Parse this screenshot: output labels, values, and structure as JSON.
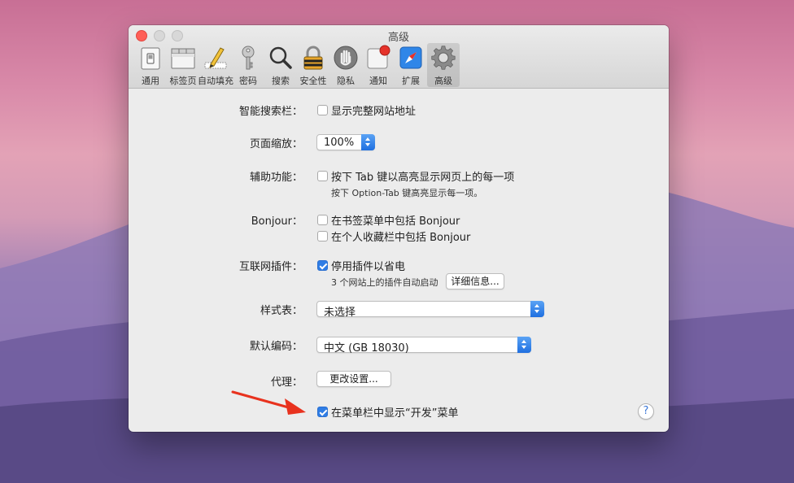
{
  "window": {
    "title": "高级"
  },
  "toolbar": {
    "items": [
      {
        "label": "通用",
        "icon": "general-switch-icon"
      },
      {
        "label": "标签页",
        "icon": "tabs-window-icon"
      },
      {
        "label": "自动填充",
        "icon": "pencil-form-icon"
      },
      {
        "label": "密码",
        "icon": "key-icon"
      },
      {
        "label": "搜索",
        "icon": "magnifier-icon"
      },
      {
        "label": "安全性",
        "icon": "padlock-icon"
      },
      {
        "label": "隐私",
        "icon": "hand-icon"
      },
      {
        "label": "通知",
        "icon": "notification-icon"
      },
      {
        "label": "扩展",
        "icon": "safari-compass-icon"
      },
      {
        "label": "高级",
        "icon": "gear-icon",
        "selected": true
      }
    ]
  },
  "settings": {
    "smart_search": {
      "label": "智能搜索栏：",
      "option": "显示完整网站地址",
      "checked": false
    },
    "zoom": {
      "label": "页面缩放：",
      "value": "100%"
    },
    "accessibility": {
      "label": "辅助功能：",
      "option": "按下 Tab 键以高亮显示网页上的每一项",
      "hint": "按下 Option-Tab 键高亮显示每一项。",
      "checked": false
    },
    "bonjour": {
      "label": "Bonjour：",
      "option1": "在书签菜单中包括 Bonjour",
      "option2": "在个人收藏栏中包括 Bonjour",
      "checked1": false,
      "checked2": false
    },
    "plugins": {
      "label": "互联网插件：",
      "option": "停用插件以省电",
      "checked": true,
      "info": "3 个网站上的插件自动启动",
      "details_button": "详细信息..."
    },
    "stylesheet": {
      "label": "样式表：",
      "value": "未选择"
    },
    "encoding": {
      "label": "默认编码：",
      "value": "中文 (GB 18030)"
    },
    "proxy": {
      "label": "代理：",
      "button": "更改设置..."
    },
    "develop_menu": {
      "option": "在菜单栏中显示“开发”菜单",
      "checked": true
    },
    "help": "?"
  },
  "colors": {
    "accent": "#2f7de5",
    "close": "#ff5f57",
    "arrow": "#e8321e"
  }
}
